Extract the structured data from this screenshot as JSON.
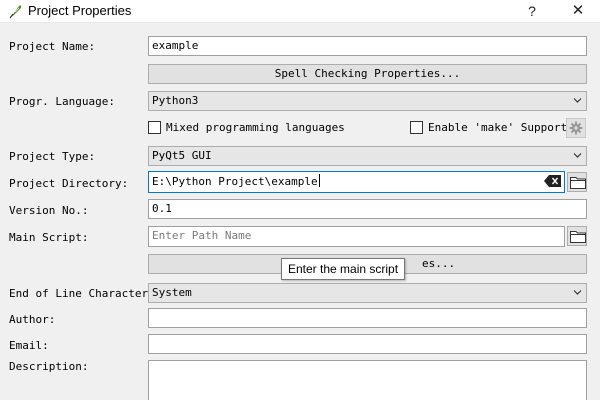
{
  "window": {
    "title": "Project Properties",
    "help_label": "?",
    "close_label": "✕",
    "icon": "quill-pen-icon"
  },
  "labels": {
    "project_name": "Project Name:",
    "progr_language": "Progr. Language:",
    "project_type": "Project Type:",
    "project_directory": "Project Directory:",
    "version_no": "Version No.:",
    "main_script": "Main Script:",
    "end_of_line": "End of Line Character:",
    "author": "Author:",
    "email": "Email:",
    "description": "Description:"
  },
  "fields": {
    "project_name": "example",
    "project_directory": "E:\\Python Project\\example",
    "version_no": "0.1",
    "main_script_value": "",
    "main_script_placeholder": "Enter Path Name",
    "author": "",
    "email": "",
    "description": ""
  },
  "combos": {
    "progr_language": "Python3",
    "project_type": "PyQt5 GUI",
    "end_of_line": "System"
  },
  "buttons": {
    "spell_checking": "Spell Checking Properties...",
    "hidden_button_visible_suffix": "es..."
  },
  "checkboxes": {
    "mixed_languages": {
      "label": "Mixed programming languages",
      "checked": false
    },
    "enable_make": {
      "label": "Enable 'make' Support",
      "checked": false
    }
  },
  "tooltip": {
    "text": "Enter the main script"
  }
}
